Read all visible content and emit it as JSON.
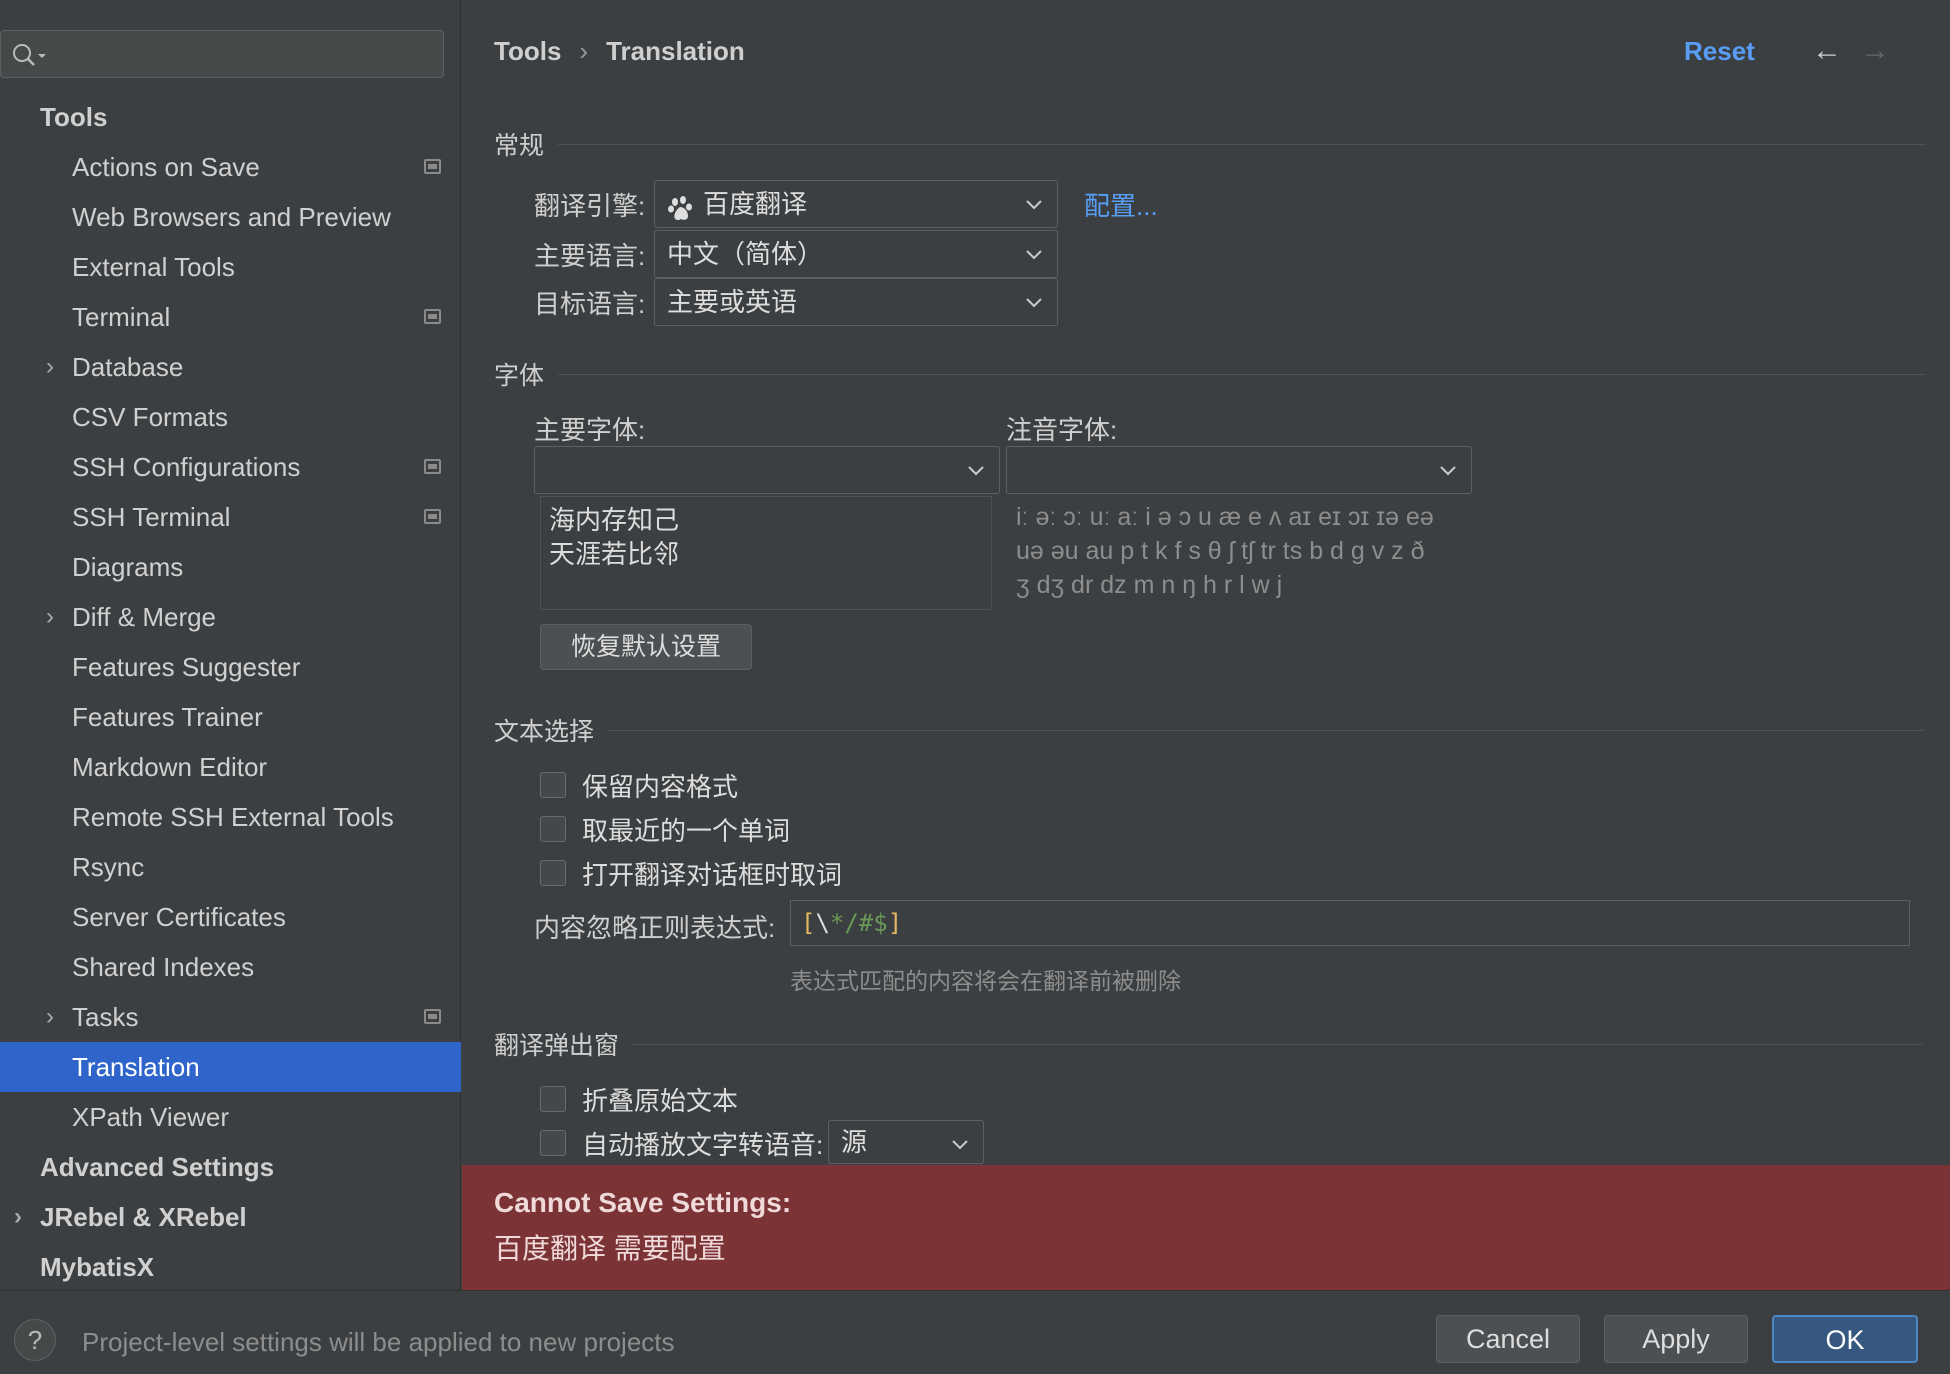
{
  "search": {
    "placeholder": ""
  },
  "sidebar": {
    "items": [
      {
        "label": "Tools",
        "level": 0,
        "expandable": false,
        "selected": false,
        "project_icon": false
      },
      {
        "label": "Actions on Save",
        "level": 1,
        "expandable": false,
        "selected": false,
        "project_icon": true
      },
      {
        "label": "Web Browsers and Preview",
        "level": 1,
        "expandable": false,
        "selected": false,
        "project_icon": false
      },
      {
        "label": "External Tools",
        "level": 1,
        "expandable": false,
        "selected": false,
        "project_icon": false
      },
      {
        "label": "Terminal",
        "level": 1,
        "expandable": false,
        "selected": false,
        "project_icon": true
      },
      {
        "label": "Database",
        "level": 1,
        "expandable": true,
        "selected": false,
        "project_icon": false
      },
      {
        "label": "CSV Formats",
        "level": 1,
        "expandable": false,
        "selected": false,
        "project_icon": false
      },
      {
        "label": "SSH Configurations",
        "level": 1,
        "expandable": false,
        "selected": false,
        "project_icon": true
      },
      {
        "label": "SSH Terminal",
        "level": 1,
        "expandable": false,
        "selected": false,
        "project_icon": true
      },
      {
        "label": "Diagrams",
        "level": 1,
        "expandable": false,
        "selected": false,
        "project_icon": false
      },
      {
        "label": "Diff & Merge",
        "level": 1,
        "expandable": true,
        "selected": false,
        "project_icon": false
      },
      {
        "label": "Features Suggester",
        "level": 1,
        "expandable": false,
        "selected": false,
        "project_icon": false
      },
      {
        "label": "Features Trainer",
        "level": 1,
        "expandable": false,
        "selected": false,
        "project_icon": false
      },
      {
        "label": "Markdown Editor",
        "level": 1,
        "expandable": false,
        "selected": false,
        "project_icon": false
      },
      {
        "label": "Remote SSH External Tools",
        "level": 1,
        "expandable": false,
        "selected": false,
        "project_icon": false
      },
      {
        "label": "Rsync",
        "level": 1,
        "expandable": false,
        "selected": false,
        "project_icon": false
      },
      {
        "label": "Server Certificates",
        "level": 1,
        "expandable": false,
        "selected": false,
        "project_icon": false
      },
      {
        "label": "Shared Indexes",
        "level": 1,
        "expandable": false,
        "selected": false,
        "project_icon": false
      },
      {
        "label": "Tasks",
        "level": 1,
        "expandable": true,
        "selected": false,
        "project_icon": true
      },
      {
        "label": "Translation",
        "level": 1,
        "expandable": false,
        "selected": true,
        "project_icon": false
      },
      {
        "label": "XPath Viewer",
        "level": 1,
        "expandable": false,
        "selected": false,
        "project_icon": false
      },
      {
        "label": "Advanced Settings",
        "level": 0,
        "expandable": false,
        "selected": false,
        "project_icon": false
      },
      {
        "label": "JRebel & XRebel",
        "level": 0,
        "expandable": true,
        "selected": false,
        "project_icon": false
      },
      {
        "label": "MybatisX",
        "level": 0,
        "expandable": false,
        "selected": false,
        "project_icon": false
      }
    ]
  },
  "header": {
    "breadcrumb": [
      "Tools",
      "Translation"
    ],
    "breadcrumb_separator": "›",
    "reset": "Reset",
    "back_glyph": "←",
    "forward_glyph": "→"
  },
  "general": {
    "title": "常规",
    "engine_label": "翻译引擎:",
    "engine_value": "百度翻译",
    "engine_icon": "baidu-paw-icon",
    "configure_link": "配置...",
    "primary_lang_label": "主要语言:",
    "primary_lang_value": "中文（简体）",
    "target_lang_label": "目标语言:",
    "target_lang_value": "主要或英语"
  },
  "fonts": {
    "title": "字体",
    "primary_label": "主要字体:",
    "primary_value": "",
    "phonetic_label": "注音字体:",
    "phonetic_value": "",
    "preview_lines": [
      "海内存知己",
      "天涯若比邻"
    ],
    "ipa_lines": [
      "iː əː ɔː uː aː i ə ɔ u æ e ʌ aɪ eɪ ɔɪ ɪə eə",
      "uə əu au p t k f s θ ʃ tʃ tr ts b d g v z ð",
      "ʒ dʒ dr dz m n ŋ h r l w j"
    ],
    "restore_button": "恢复默认设置"
  },
  "selection": {
    "title": "文本选择",
    "checkboxes": [
      {
        "label": "保留内容格式",
        "checked": false
      },
      {
        "label": "取最近的一个单词",
        "checked": false
      },
      {
        "label": "打开翻译对话框时取词",
        "checked": false
      }
    ],
    "regex_label": "内容忽略正则表达式:",
    "regex_parts": {
      "open": "[",
      "escape": "\\",
      "symbols": "*/#$",
      "close": "]"
    },
    "regex_hint": "表达式匹配的内容将会在翻译前被删除"
  },
  "popup": {
    "title": "翻译弹出窗",
    "fold_label": "折叠原始文本",
    "fold_checked": false,
    "autoplay_label": "自动播放文字转语音:",
    "autoplay_checked": false,
    "autoplay_value": "源"
  },
  "error": {
    "title": "Cannot Save Settings:",
    "message": "百度翻译 需要配置",
    "bg_color": "#7b3336"
  },
  "footer": {
    "help": "?",
    "note": "Project-level settings will be applied to new projects",
    "cancel": "Cancel",
    "apply": "Apply",
    "ok": "OK"
  },
  "colors": {
    "accent": "#2f65ca",
    "link": "#589df6",
    "background": "#3c3f41"
  }
}
